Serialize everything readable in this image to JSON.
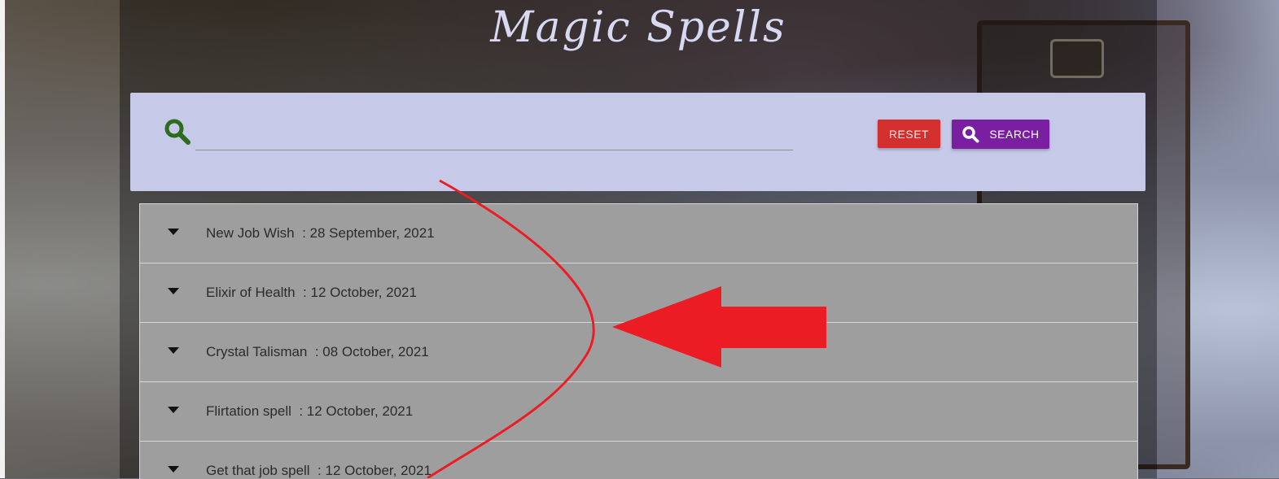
{
  "page": {
    "title": "Magic Spells"
  },
  "search": {
    "input_value": "",
    "placeholder": "",
    "reset_label": "RESET",
    "search_label": "SEARCH"
  },
  "spells": [
    {
      "name": "New Job Wish",
      "date": "28 September, 2021"
    },
    {
      "name": "Elixir of Health",
      "date": "12 October, 2021"
    },
    {
      "name": "Crystal Talisman",
      "date": "08 October, 2021"
    },
    {
      "name": "Flirtation spell",
      "date": "12 October, 2021"
    },
    {
      "name": "Get that job spell",
      "date": "12 October, 2021"
    }
  ],
  "icons": {
    "search_panel_icon": "search-icon",
    "search_button_icon": "search-icon",
    "row_expand_icon": "caret-down-icon"
  },
  "colors": {
    "search_panel_bg": "#c6c9e8",
    "reset_button": "#d32f2f",
    "search_button": "#7b1fa2",
    "list_row_bg": "#9e9e9e",
    "annotation_red": "#ec1c24",
    "search_icon_green": "#2e6b1e"
  }
}
